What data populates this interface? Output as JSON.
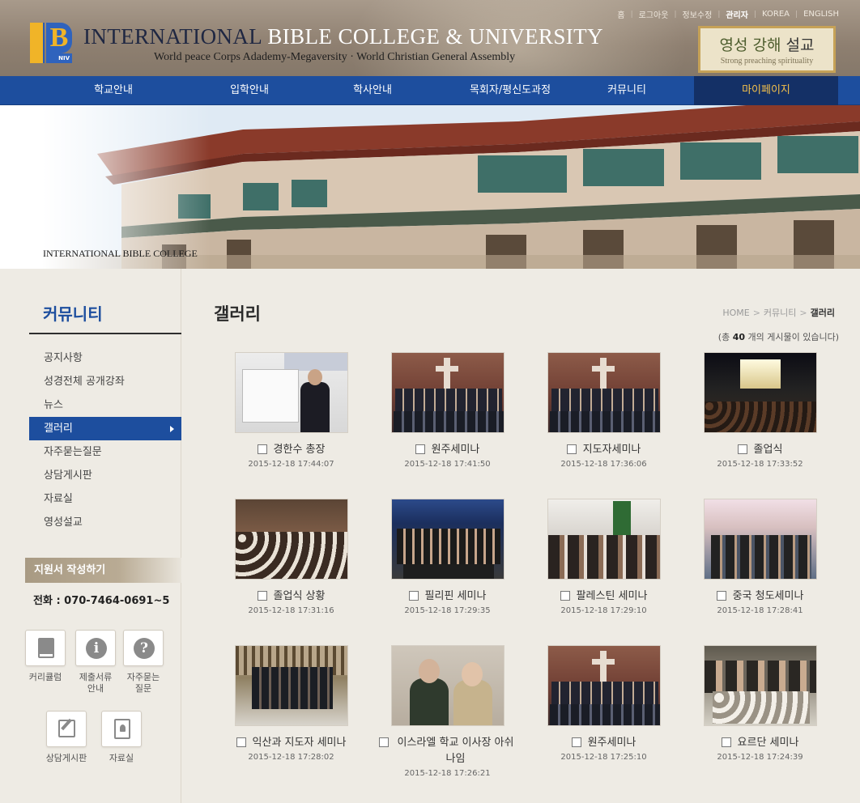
{
  "top_links": [
    "홈",
    "로그아웃",
    "정보수정",
    "관리자",
    "KOREA",
    "ENGLISH"
  ],
  "header": {
    "title_part1": "INTERNATIONAL",
    "title_part2": "BIBLE COLLEGE & UNIVERSITY",
    "subtitle": "World peace Corps Adademy-Megaversity · World Christian General Assembly",
    "logo_text": "B",
    "logo_sub": "NIV",
    "preach_korean_a": "영성 강해 ",
    "preach_korean_b": "설교",
    "preach_english": "Strong preaching spirituality"
  },
  "nav": {
    "items": [
      "학교안내",
      "입학안내",
      "학사안내",
      "목회자/평신도과정",
      "커뮤니티",
      "마이페이지"
    ],
    "active_index": 5
  },
  "banner": {
    "caption": "INTERNATIONAL BIBLE COLLEGE"
  },
  "sidebar": {
    "title": "커뮤니티",
    "items": [
      "공지사항",
      "성경전체 공개강좌",
      "뉴스",
      "갤러리",
      "자주묻는질문",
      "상담게시판",
      "자료실",
      "영성설교"
    ],
    "active_index": 3,
    "apply_label": "지원서 작성하기",
    "phone": "전화 : 070-7464-0691~5",
    "quick_links": [
      {
        "label": "커리큘럼",
        "icon": "book-icon"
      },
      {
        "label": "제출서류\n안내",
        "icon": "info-icon"
      },
      {
        "label": "자주묻는\n질문",
        "icon": "question-icon"
      },
      {
        "label": "상담게시판",
        "icon": "edit-icon"
      },
      {
        "label": "자료실",
        "icon": "contact-book-icon"
      }
    ]
  },
  "content": {
    "title": "갤러리",
    "breadcrumb": [
      "HOME",
      "커뮤니티",
      "갤러리"
    ],
    "total_prefix": "(총 ",
    "total_count": "40",
    "total_suffix": " 개의 게시물이 있습니다)",
    "gallery": [
      {
        "title": "경한수 총장",
        "date": "2015-12-18 17:44:07"
      },
      {
        "title": "원주세미나",
        "date": "2015-12-18 17:41:50"
      },
      {
        "title": "지도자세미나",
        "date": "2015-12-18 17:36:06"
      },
      {
        "title": "졸업식",
        "date": "2015-12-18 17:33:52"
      },
      {
        "title": "졸업식 상황",
        "date": "2015-12-18 17:31:16"
      },
      {
        "title": "필리핀 세미나",
        "date": "2015-12-18 17:29:35"
      },
      {
        "title": "팔레스틴 세미나",
        "date": "2015-12-18 17:29:10"
      },
      {
        "title": "중국 청도세미나",
        "date": "2015-12-18 17:28:41"
      },
      {
        "title": "익산과 지도자 세미나",
        "date": "2015-12-18 17:28:02"
      },
      {
        "title": "이스라엘 학교 이사장 아쉬나임",
        "date": "2015-12-18 17:26:21"
      },
      {
        "title": "원주세미나",
        "date": "2015-12-18 17:25:10"
      },
      {
        "title": "요르단 세미나",
        "date": "2015-12-18 17:24:39"
      }
    ]
  }
}
